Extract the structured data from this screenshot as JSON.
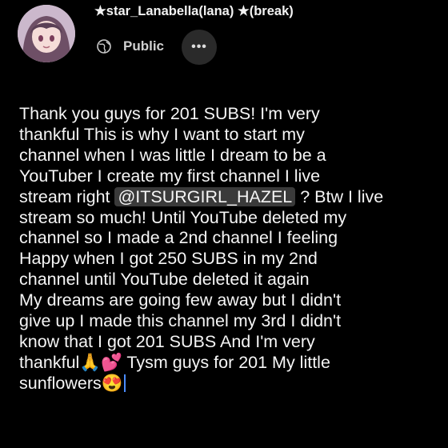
{
  "post": {
    "author": "★star_Lanabella(lana) ★(break)",
    "visibility": "Public",
    "more_icon": "•••",
    "lines": [
      "Thank you guys for 201 SUBS! I'm very",
      "thankful This is why I want to start my",
      "channel when I was little I dream to be a",
      "YouTuber I create my first channel I live"
    ],
    "line5_before": "stream right ",
    "mention": "@ITSURGIRL_HAZEL",
    "line5_after": " ? Btw I live",
    "lines_b": [
      "stream so much! Until YouTube deleted my",
      "channel so I made a 2nd channel I feeling",
      "Happy when I got 250 SUBS in my 2nd",
      "channel until YouTube deleted it again",
      "My dreams are going few away but I didn't",
      "give up I made this channel my 3rd I didn't",
      "know that I got 201 SUBS And I'm very"
    ],
    "line13": "thankful🙏💕 Tysm guys for 201 My little",
    "line14": "sunflowers😍"
  },
  "colors": {
    "background": "#000000",
    "text": "#f5f5f5",
    "cursor": "#4a8cff"
  }
}
